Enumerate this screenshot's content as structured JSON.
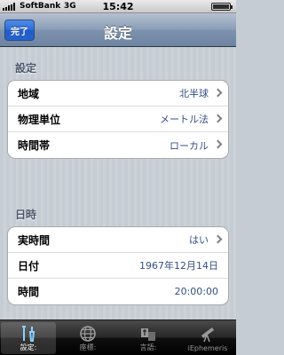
{
  "status_bar": {
    "carrier": "SoftBank",
    "network": "3G",
    "time": "15:42"
  },
  "nav_bar": {
    "done_label": "完了",
    "title": "設定"
  },
  "settings_section": {
    "header": "設定",
    "rows": [
      {
        "label": "地域",
        "value": "北半球"
      },
      {
        "label": "物理単位",
        "value": "メートル法"
      },
      {
        "label": "時間帯",
        "value": "ローカル"
      }
    ]
  },
  "datetime_section": {
    "header": "日時",
    "rows": [
      {
        "label": "実時間",
        "value": "はい"
      },
      {
        "label": "日付",
        "value": "1967年12月14日"
      },
      {
        "label": "時間",
        "value": "20:00:00"
      }
    ]
  },
  "tab_bar": {
    "tabs": [
      {
        "label": "設定:",
        "icon": "tools-icon",
        "selected": true
      },
      {
        "label": "座標:",
        "icon": "globe-icon",
        "selected": false
      },
      {
        "label": "言語:",
        "icon": "language-icon",
        "selected": false
      },
      {
        "label": "iEphemeris",
        "icon": "telescope-icon",
        "selected": false
      }
    ]
  },
  "colors": {
    "nav_bar": "#7e92ae",
    "done_button": "#2b6bd6",
    "value_text": "#324f85",
    "section_header": "#4c566c"
  }
}
